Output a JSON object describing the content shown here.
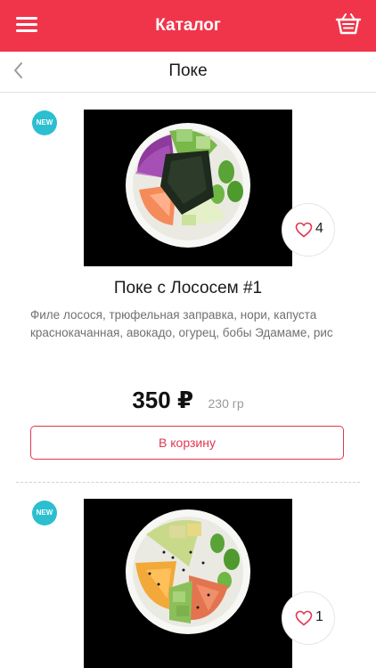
{
  "header": {
    "title": "Каталог",
    "menu_icon": "hamburger-menu-icon",
    "cart_icon": "basket-icon",
    "background": "#f0354b"
  },
  "subheader": {
    "back_icon": "chevron-left-icon",
    "title": "Поке"
  },
  "products": [
    {
      "badge": "NEW",
      "name": "Поке с Лососем #1",
      "description": "Филе лосося, трюфельная заправка, нори, капуста краснокачанная, авокадо, огурец, бобы Эдамаме, рис",
      "price": "350 ₽",
      "weight": "230 гр",
      "likes": "4",
      "button_label": "В корзину"
    },
    {
      "badge": "NEW",
      "likes": "1"
    }
  ],
  "colors": {
    "accent": "#f0354b",
    "badge": "#2bbfd0",
    "button_border": "#e0384e"
  }
}
